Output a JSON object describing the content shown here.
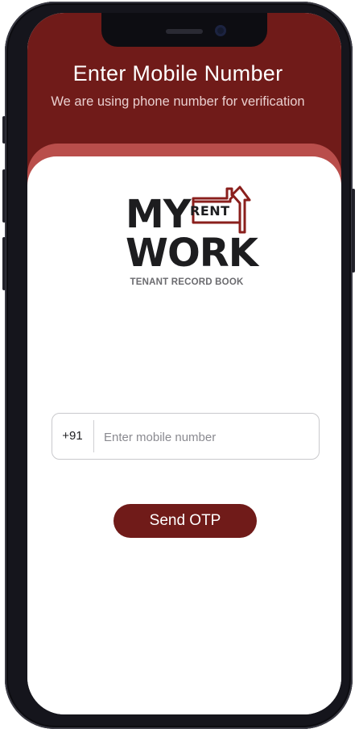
{
  "header": {
    "title": "Enter Mobile Number",
    "subtitle": "We are using phone number for verification"
  },
  "logo": {
    "line1": "MY",
    "line2": "WORK",
    "rent": "RENT",
    "tagline": "TENANT RECORD BOOK"
  },
  "form": {
    "country_code": "+91",
    "mobile_placeholder": "Enter mobile number",
    "mobile_value": "",
    "send_label": "Send OTP"
  },
  "colors": {
    "brand_dark": "#701b19",
    "brand_light": "#b94e4b",
    "text_dark": "#1d1d1f"
  }
}
